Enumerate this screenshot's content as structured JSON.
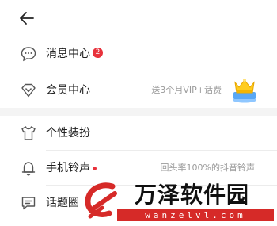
{
  "header": {
    "back_icon": "arrow-left-icon"
  },
  "menu": {
    "messages": {
      "label": "消息中心",
      "badge": "2",
      "icon": "chat-bubble-icon"
    },
    "vip": {
      "label": "会员中心",
      "promo": "送3个月VIP+话费",
      "icon": "diamond-icon"
    },
    "decorate": {
      "label": "个性装扮",
      "icon": "tshirt-icon"
    },
    "ringtone": {
      "label": "手机铃声",
      "subtitle": "回头率100%的抖音铃声",
      "icon": "bell-icon"
    },
    "topics": {
      "label": "话题圈",
      "icon": "message-square-icon"
    }
  },
  "watermark": {
    "title": "万泽软件园",
    "url": "wanzelvl.com"
  },
  "colors": {
    "accent": "#e8323c",
    "divider": "#ececec",
    "section_gap": "#f4f4f4",
    "muted_text": "#9b9b9b"
  }
}
